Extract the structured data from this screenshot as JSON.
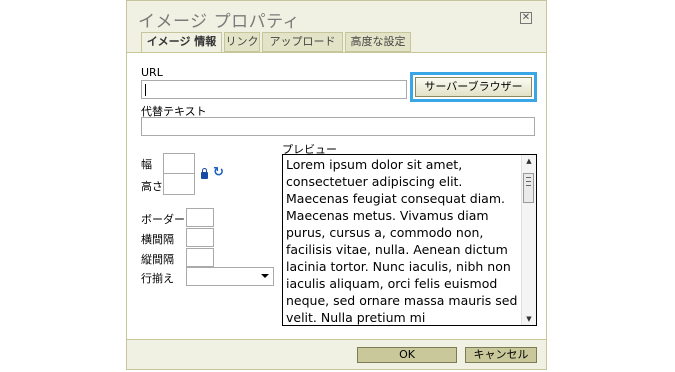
{
  "dialog": {
    "title": "イメージ プロパティ",
    "close_icon": "close-icon"
  },
  "tabs": [
    {
      "label": "イメージ 情報",
      "active": true
    },
    {
      "label": "リンク",
      "active": false
    },
    {
      "label": "アップロード",
      "active": false
    },
    {
      "label": "高度な設定",
      "active": false
    }
  ],
  "form": {
    "url_label": "URL",
    "url_value": "",
    "browse_button": "サーバーブラウザー",
    "alt_label": "代替テキスト",
    "alt_value": "",
    "width_label": "幅",
    "height_label": "高さ",
    "border_label": "ボーダー",
    "hspace_label": "横間隔",
    "vspace_label": "縦間隔",
    "align_label": "行揃え",
    "align_value": "",
    "lock_icon": "lock-icon",
    "reset_icon": "reset-size-icon"
  },
  "preview": {
    "label": "プレビュー",
    "text": "Lorem ipsum dolor sit amet, consectetuer adipiscing elit. Maecenas feugiat consequat diam. Maecenas metus. Vivamus diam purus, cursus a, commodo non, facilisis vitae, nulla. Aenean dictum lacinia tortor. Nunc iaculis, nibh non iaculis aliquam, orci felis euismod neque, sed ornare massa mauris sed velit. Nulla pretium mi"
  },
  "footer": {
    "ok_label": "OK",
    "cancel_label": "キャンセル"
  },
  "colors": {
    "dialog_bg": "#f1f1e3",
    "highlight": "#3aa6e6"
  }
}
